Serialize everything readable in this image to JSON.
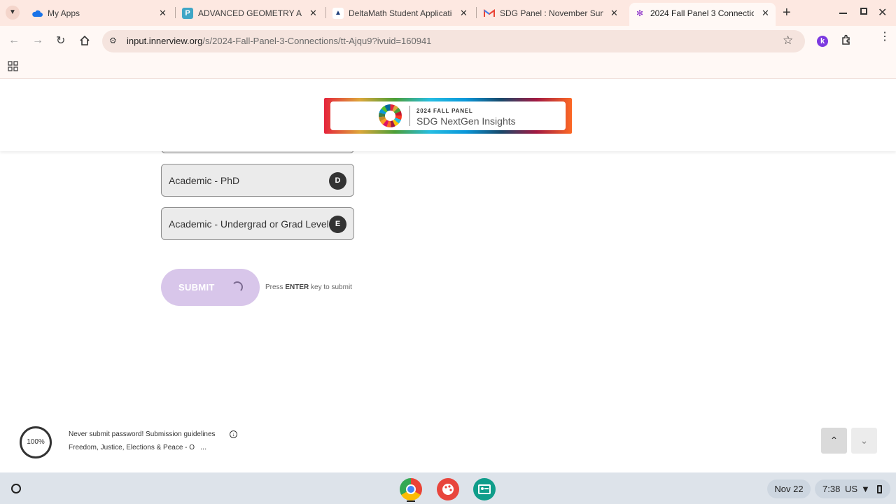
{
  "browser": {
    "tabs": [
      {
        "title": "My Apps",
        "icon": "onedrive-cloud-icon"
      },
      {
        "title": "ADVANCED GEOMETRY A: Se",
        "icon": "pear-deck-icon"
      },
      {
        "title": "DeltaMath Student Applicatio",
        "icon": "deltamath-cap-icon"
      },
      {
        "title": "SDG Panel : November Surve",
        "icon": "gmail-icon"
      },
      {
        "title": "2024 Fall Panel 3 Connection",
        "icon": "innerview-icon",
        "active": true
      }
    ],
    "url_host": "input.innerview.org",
    "url_path": "/s/2024-Fall-Panel-3-Connections/tt-Ajqu9?ivuid=160941",
    "profile_initial": "k"
  },
  "banner": {
    "line1": "2024 FALL PANEL",
    "line2": "SDG NextGen Insights"
  },
  "choices": [
    {
      "label": "Academic - PhD",
      "key": "D"
    },
    {
      "label": "Academic - Undergrad or Grad Level",
      "key": "E"
    }
  ],
  "submit": {
    "label": "SUBMIT",
    "hint_prefix": "Press",
    "hint_key": "ENTER",
    "hint_suffix": "key to submit"
  },
  "footer": {
    "progress": "100%",
    "guidelines": "Never submit password! Submission guidelines",
    "section": "Freedom, Justice, Elections & Peace - O",
    "ellipsis": "..."
  },
  "shelf": {
    "date": "Nov 22",
    "time": "7:38",
    "region": "US"
  },
  "colors": {
    "tabstrip": "#fde8e1",
    "submit_disabled": "#d8c6ea",
    "key_badge": "#333333"
  }
}
